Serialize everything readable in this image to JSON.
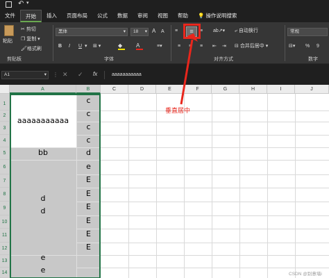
{
  "ribbon_tabs": [
    "文件",
    "开始",
    "插入",
    "页面布局",
    "公式",
    "数据",
    "审阅",
    "视图",
    "帮助"
  ],
  "tell_me": "操作说明搜索",
  "clipboard": {
    "paste": "粘贴",
    "cut": "剪切",
    "copy": "复制",
    "format_painter": "格式刷",
    "label": "剪贴板"
  },
  "font": {
    "name": "黑体",
    "size": "18",
    "bold": "B",
    "italic": "I",
    "underline": "U",
    "label": "字体",
    "grow": "A",
    "shrink": "A"
  },
  "alignment": {
    "wrap": "自动换行",
    "merge": "合并后居中",
    "label": "对齐方式"
  },
  "number": {
    "format": "常规",
    "percent": "%",
    "comma": "9",
    "label": "数字"
  },
  "name_box": "A1",
  "formula_value": "aaaaaaaaaaa",
  "fx": "fx",
  "columns": [
    "A",
    "B",
    "C",
    "D",
    "E",
    "F",
    "G",
    "H",
    "I",
    "J"
  ],
  "rows": [
    "1",
    "2",
    "3",
    "4",
    "5",
    "6",
    "7",
    "8",
    "9",
    "10",
    "11",
    "12",
    "13",
    "14"
  ],
  "cells": {
    "a_merged_1": "aaaaaaaaaaa",
    "a_row5": "bb",
    "a_d1": "d",
    "a_d2": "d",
    "a_e1": "e",
    "a_e2": "e",
    "b": [
      "c",
      "c",
      "c",
      "c",
      "d",
      "e",
      "E",
      "E",
      "E",
      "E",
      "E",
      "E"
    ]
  },
  "annotation": "垂直居中",
  "watermark": "CSDN @别意墙i",
  "colors": {
    "accent": "#217346",
    "annotation_red": "#e8261c",
    "selection": "#c8c8c8"
  }
}
